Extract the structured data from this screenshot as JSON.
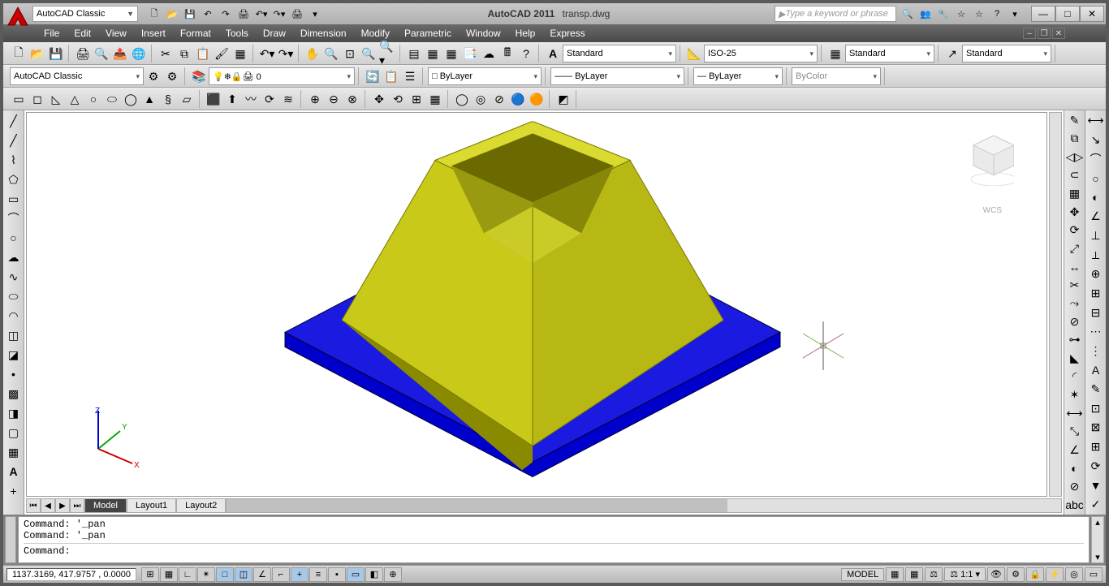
{
  "title": {
    "app": "AutoCAD 2011",
    "file": "transp.dwg"
  },
  "workspace": "AutoCAD Classic",
  "search_placeholder": "Type a keyword or phrase",
  "menus": [
    "File",
    "Edit",
    "View",
    "Insert",
    "Format",
    "Tools",
    "Draw",
    "Dimension",
    "Modify",
    "Parametric",
    "Window",
    "Help",
    "Express"
  ],
  "tb1_styles": {
    "text": "Standard",
    "dim": "ISO-25",
    "table": "Standard",
    "mleader": "Standard"
  },
  "tb2": {
    "workspace": "AutoCAD Classic",
    "layer": "0",
    "bylayer1": "ByLayer",
    "lineweight": "ByLayer",
    "linetype": "ByLayer",
    "color": "ByColor"
  },
  "tabs": {
    "model": "Model",
    "l1": "Layout1",
    "l2": "Layout2"
  },
  "wcs": "WCS",
  "cmd": {
    "l1": "Command: '_pan",
    "l2": "Command: '_pan",
    "l3": "Command:"
  },
  "status": {
    "coords": "1137.3169, 417.9757 , 0.0000",
    "model": "MODEL",
    "scale": "1:1"
  }
}
